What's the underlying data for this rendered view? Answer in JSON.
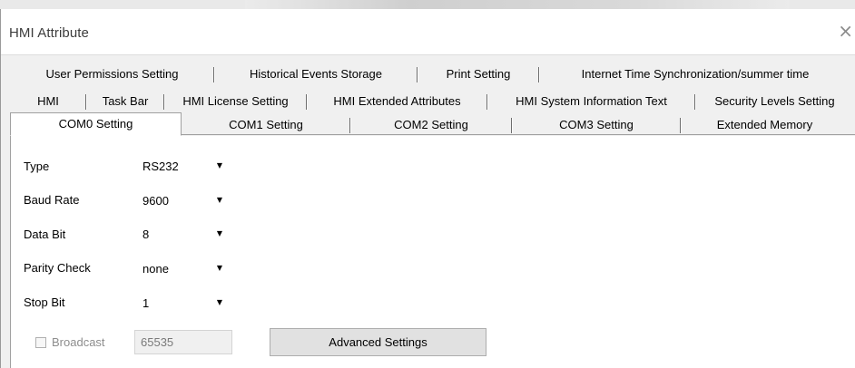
{
  "window": {
    "title": "HMI Attribute",
    "close_glyph": "×"
  },
  "tabs": {
    "row1": [
      "User Permissions Setting",
      "Historical Events Storage",
      "Print Setting",
      "Internet Time Synchronization/summer time"
    ],
    "row2": [
      "HMI",
      "Task Bar",
      "HMI License Setting",
      "HMI Extended Attributes",
      "HMI System Information Text",
      "Security Levels Setting"
    ],
    "row3": [
      "COM0 Setting",
      "COM1 Setting",
      "COM2 Setting",
      "COM3 Setting",
      "Extended Memory"
    ],
    "selected": "COM0 Setting"
  },
  "form": {
    "type": {
      "label": "Type",
      "value": "RS232"
    },
    "baud_rate": {
      "label": "Baud Rate",
      "value": "9600"
    },
    "data_bit": {
      "label": "Data Bit",
      "value": "8"
    },
    "parity_check": {
      "label": "Parity Check",
      "value": "none"
    },
    "stop_bit": {
      "label": "Stop Bit",
      "value": "1"
    },
    "broadcast": {
      "label": "Broadcast",
      "checked": false,
      "enabled": false,
      "value": "65535"
    },
    "advanced_button": "Advanced Settings"
  },
  "icons": {
    "close": "close-icon",
    "dropdown": "chevron-down-icon",
    "dropdown_glyph": "▼"
  }
}
